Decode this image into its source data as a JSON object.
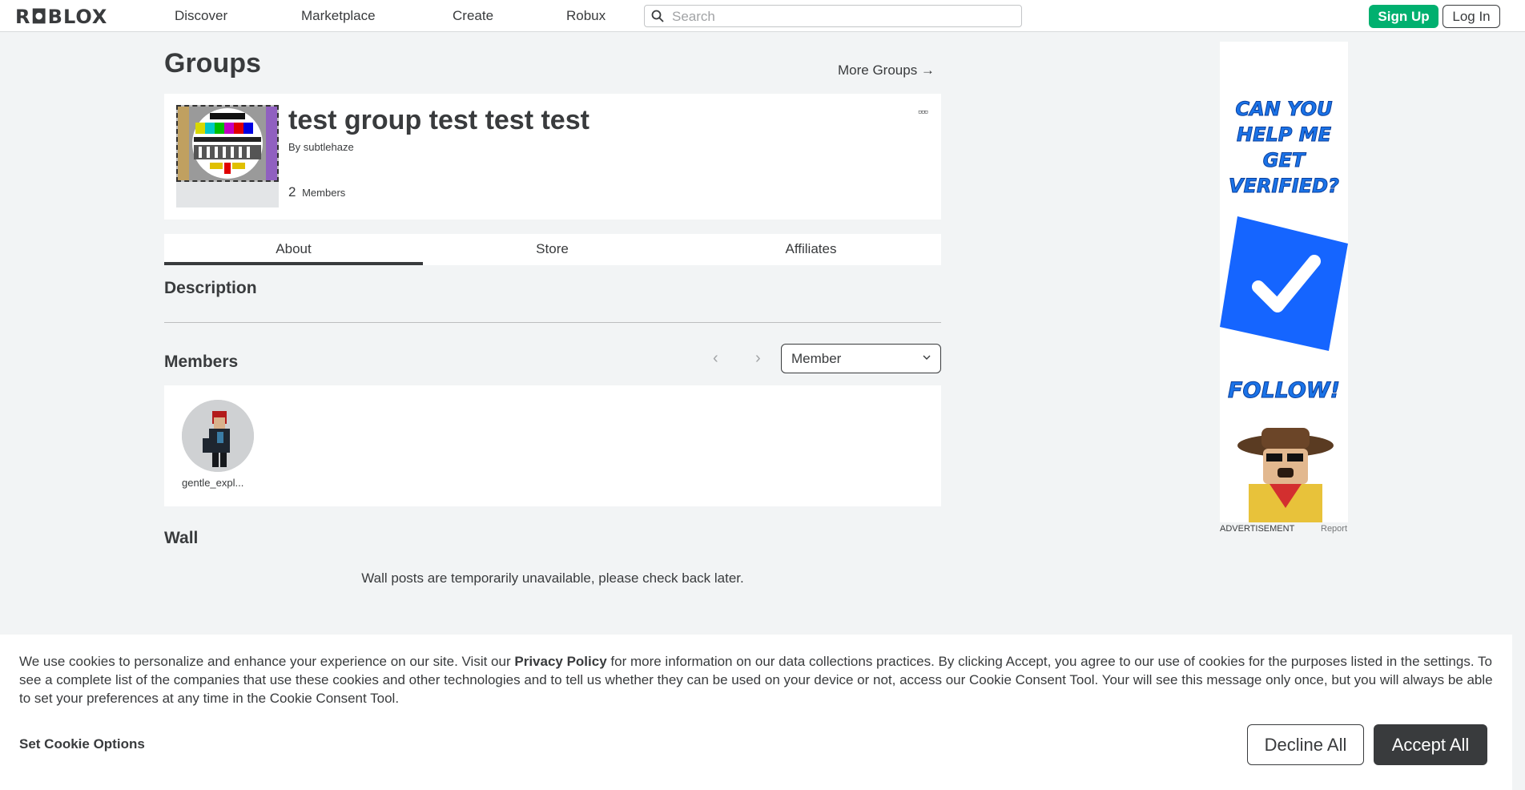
{
  "header": {
    "logo": "R◘BLOX",
    "nav": [
      "Discover",
      "Marketplace",
      "Create",
      "Robux"
    ],
    "search_placeholder": "Search",
    "signup_label": "Sign Up",
    "login_label": "Log In"
  },
  "page": {
    "title": "Groups",
    "more_groups": "More Groups →"
  },
  "group": {
    "name": "test group test test test",
    "by_prefix": "By",
    "owner": "subtlehaze",
    "member_count": "2",
    "member_label": "Members",
    "more_menu": "▫▫▫"
  },
  "tabs": [
    "About",
    "Store",
    "Affiliates"
  ],
  "sections": {
    "description": "Description",
    "members": "Members",
    "wall": "Wall"
  },
  "members": {
    "pager_prev": "‹",
    "pager_next": "›",
    "role_selected": "Member",
    "list": [
      {
        "name": "gentle_expl..."
      }
    ]
  },
  "wall": {
    "message": "Wall posts are temporarily unavailable, please check back later."
  },
  "ad": {
    "line1": "CAN YOU",
    "line2": "HELP ME",
    "line3": "GET",
    "line4": "VERIFIED?",
    "follow": "FOLLOW!",
    "label": "ADVERTISEMENT",
    "report": "Report"
  },
  "cookie": {
    "text_before": "We use cookies to personalize and enhance your experience on our site. Visit our ",
    "privacy_link": "Privacy Policy",
    "text_after": " for more information on our data collections practices. By clicking Accept, you agree to our use of cookies for the purposes listed in the settings. To see a complete list of the companies that use these cookies and other technologies and to tell us whether they can be used on your device or not, access our Cookie Consent Tool. Your will see this message only once, but you will always be able to set your preferences at any time in the Cookie Consent Tool.",
    "set_options": "Set Cookie Options",
    "decline": "Decline All",
    "accept": "Accept All"
  },
  "colors": {
    "brand_green": "#00b06f",
    "text": "#393b3d",
    "ad_blue": "#1a73e8"
  }
}
